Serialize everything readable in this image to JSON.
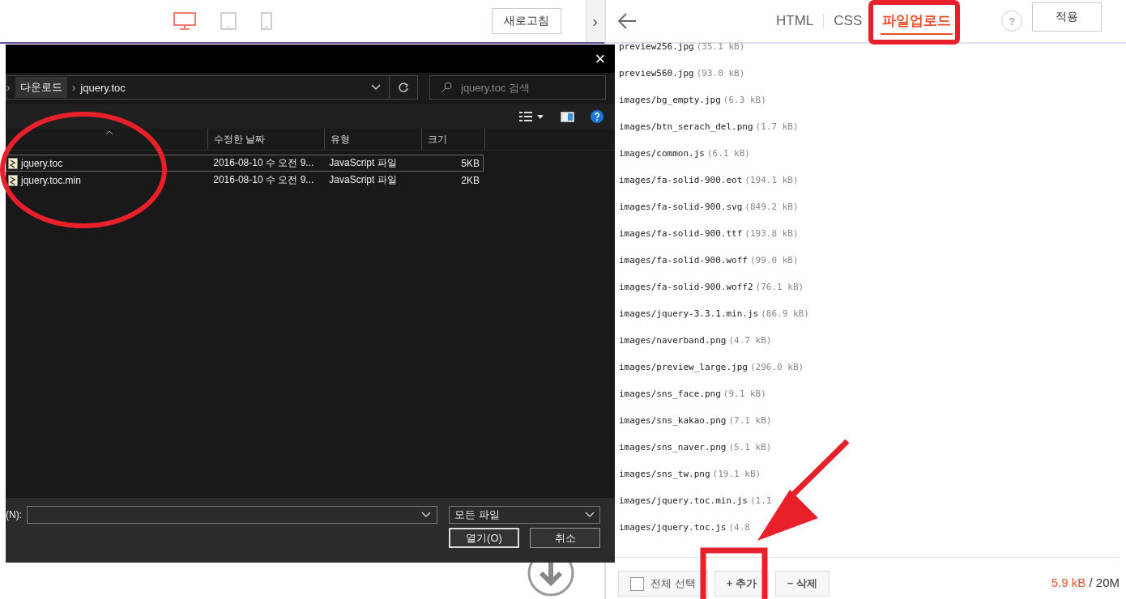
{
  "left_toolbar": {
    "devices": [
      {
        "kind": "desktop",
        "selected": true
      },
      {
        "kind": "tablet",
        "selected": false
      },
      {
        "kind": "phone",
        "selected": false
      }
    ],
    "refresh_button": "새로고침",
    "expand_button": "›"
  },
  "dialog": {
    "close": "×",
    "breadcrumb_separator": "›",
    "breadcrumbs": [
      "다운로드",
      "jquery.toc"
    ],
    "search": {
      "placeholder": "jquery.toc 검색"
    },
    "columns": [
      "수정한 날짜",
      "유형",
      "크기"
    ],
    "files": [
      {
        "name": "jquery.toc",
        "modified": "2016-08-10 수 오전 9...",
        "type": "JavaScript 파일",
        "size": "5KB",
        "selected": true
      },
      {
        "name": "jquery.toc.min",
        "modified": "2016-08-10 수 오전 9...",
        "type": "JavaScript 파일",
        "size": "2KB",
        "selected": false
      }
    ],
    "filename_label": "(N):",
    "filetype": "모든 파일",
    "buttons": [
      "열기(O)",
      "취소"
    ]
  },
  "editor": {
    "tabs": [
      {
        "label": "HTML",
        "selected": false
      },
      {
        "label": "CSS",
        "selected": false
      },
      {
        "label": "파일업로드",
        "selected": true
      }
    ],
    "help_button": "?",
    "apply_button": "적용",
    "files": [
      {
        "name": "preview256.jpg",
        "size": "(35.1 kB)"
      },
      {
        "name": "preview560.jpg",
        "size": "(93.0 kB)"
      },
      {
        "name": "images/bg_empty.jpg",
        "size": "(6.3 kB)"
      },
      {
        "name": "images/btn_serach_del.png",
        "size": "(1.7 kB)"
      },
      {
        "name": "images/common.js",
        "size": "(6.1 kB)"
      },
      {
        "name": "images/fa-solid-900.eot",
        "size": "(194.1 kB)"
      },
      {
        "name": "images/fa-solid-900.svg",
        "size": "(849.2 kB)"
      },
      {
        "name": "images/fa-solid-900.ttf",
        "size": "(193.8 kB)"
      },
      {
        "name": "images/fa-solid-900.woff",
        "size": "(99.0 kB)"
      },
      {
        "name": "images/fa-solid-900.woff2",
        "size": "(76.1 kB)"
      },
      {
        "name": "images/jquery-3.3.1.min.js",
        "size": "(86.9 kB)"
      },
      {
        "name": "images/naverband.png",
        "size": "(4.7 kB)"
      },
      {
        "name": "images/preview_large.jpg",
        "size": "(296.0 kB)"
      },
      {
        "name": "images/sns_face.png",
        "size": "(9.1 kB)"
      },
      {
        "name": "images/sns_kakao.png",
        "size": "(7.1 kB)"
      },
      {
        "name": "images/sns_naver.png",
        "size": "(5.1 kB)"
      },
      {
        "name": "images/sns_tw.png",
        "size": "(19.1 kB)"
      },
      {
        "name": "images/jquery.toc.min.js",
        "size": "(1.1"
      },
      {
        "name": "images/jquery.toc.js",
        "size": "(4.8"
      }
    ],
    "footer": {
      "select_all": {
        "label": "전체 선택",
        "checked": false
      },
      "add_button": "+ 추가",
      "delete_button": "− 삭제",
      "used": "5.9 kB",
      "limit": "/ 20M"
    }
  }
}
